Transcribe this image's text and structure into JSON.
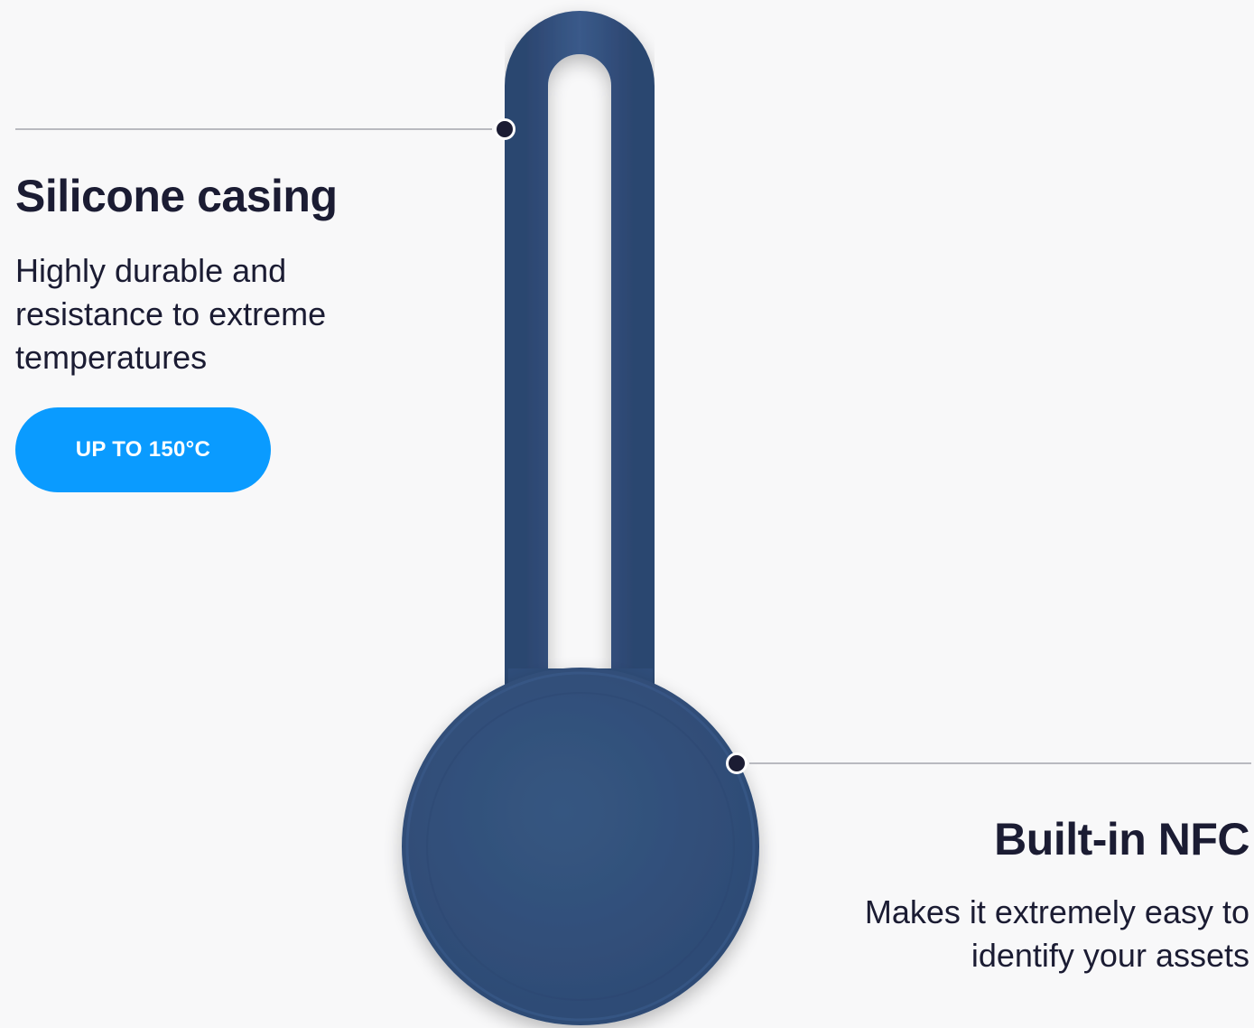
{
  "colors": {
    "background": "#f8f8f9",
    "text": "#1b1c33",
    "accent": "#0a9bff",
    "product": "#33507c",
    "callout_line": "#b9bac0"
  },
  "product_image": {
    "icon": "nfc-tag-keyring-icon"
  },
  "features": [
    {
      "title": "Silicone casing",
      "description": "Highly durable and resistance to extreme temperatures",
      "badge": "UP TO 150°C"
    },
    {
      "title": "Built-in NFC",
      "description": "Makes it extremely easy to identify your assets"
    }
  ]
}
